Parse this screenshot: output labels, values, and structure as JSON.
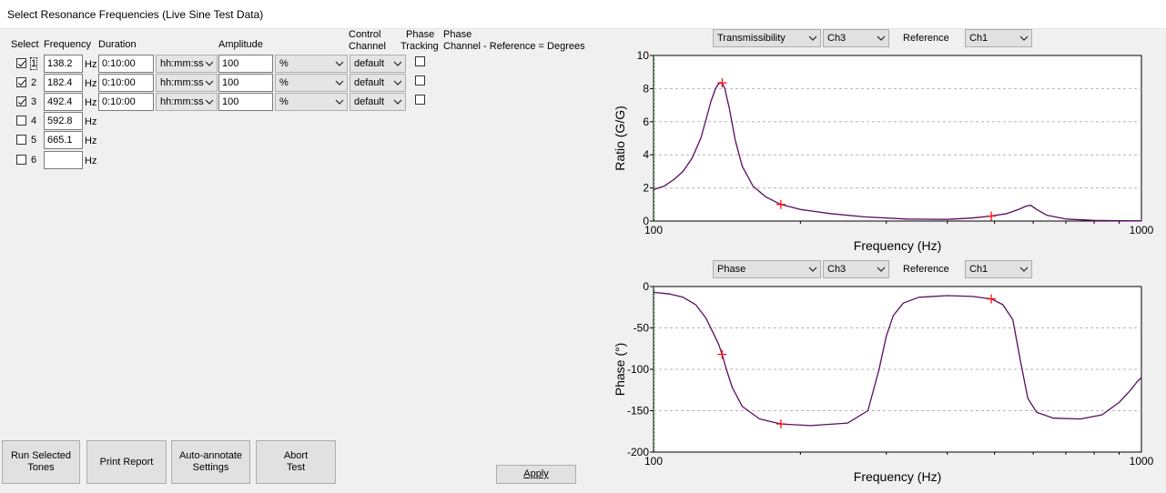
{
  "window": {
    "title": "Select Resonance Frequencies (Live Sine Test Data)"
  },
  "table": {
    "headers": {
      "select": "Select",
      "frequency": "Frequency",
      "duration": "Duration",
      "amplitude": "Amplitude",
      "control_channel_1": "Control",
      "control_channel_2": "Channel",
      "phase_tracking_1": "Phase",
      "phase_tracking_2": "Tracking",
      "phase_1": "Phase",
      "phase_2": "Channel - Reference = Degrees"
    },
    "unit": "Hz",
    "rows": [
      {
        "index": "1",
        "checked": true,
        "frequency": "138.2",
        "duration": "0:10:00",
        "duration_format": "hh:mm:ss",
        "amplitude": "100",
        "amplitude_unit": "%",
        "control_channel": "default",
        "phase_tracking": false
      },
      {
        "index": "2",
        "checked": true,
        "frequency": "182.4",
        "duration": "0:10:00",
        "duration_format": "hh:mm:ss",
        "amplitude": "100",
        "amplitude_unit": "%",
        "control_channel": "default",
        "phase_tracking": false
      },
      {
        "index": "3",
        "checked": true,
        "frequency": "492.4",
        "duration": "0:10:00",
        "duration_format": "hh:mm:ss",
        "amplitude": "100",
        "amplitude_unit": "%",
        "control_channel": "default",
        "phase_tracking": false
      },
      {
        "index": "4",
        "checked": false,
        "frequency": "592.8"
      },
      {
        "index": "5",
        "checked": false,
        "frequency": "665.1"
      },
      {
        "index": "6",
        "checked": false,
        "frequency": ""
      }
    ]
  },
  "buttons": {
    "run_selected_1": "Run Selected",
    "run_selected_2": "Tones",
    "print_report": "Print Report",
    "auto_annotate_1": "Auto-annotate",
    "auto_annotate_2": "Settings",
    "abort_1": "Abort",
    "abort_2": "Test",
    "apply": "Apply"
  },
  "graph_top": {
    "measurement": "Transmissibility",
    "channel": "Ch3",
    "reference_label": "Reference",
    "reference": "Ch1"
  },
  "graph_bottom": {
    "measurement": "Phase",
    "channel": "Ch3",
    "reference_label": "Reference",
    "reference": "Ch1"
  },
  "chart_data": [
    {
      "type": "line",
      "xlabel": "Frequency (Hz)",
      "ylabel": "Ratio (G/G)",
      "x_scale": "log",
      "xlim": [
        100,
        1000
      ],
      "ylim": [
        0,
        10
      ],
      "x_tick_labels": [
        "100",
        "1000"
      ],
      "y_ticks": [
        0,
        2,
        4,
        6,
        8,
        10
      ],
      "grid": "horizontal dashed",
      "line_color": "#5a0b63",
      "marker_color": "#ff0000",
      "x": [
        100,
        105,
        110,
        115,
        120,
        125,
        128,
        131,
        134,
        136,
        138.2,
        140,
        143,
        147,
        152,
        160,
        170,
        182.4,
        200,
        230,
        270,
        330,
        400,
        450,
        492.4,
        530,
        560,
        580,
        592.8,
        610,
        640,
        700,
        800,
        900,
        1000
      ],
      "values": [
        1.9,
        2.1,
        2.5,
        3.0,
        3.8,
        5.0,
        6.1,
        7.2,
        8.0,
        8.3,
        8.35,
        8.0,
        6.8,
        4.9,
        3.3,
        2.1,
        1.45,
        1.0,
        0.7,
        0.45,
        0.25,
        0.12,
        0.1,
        0.18,
        0.3,
        0.45,
        0.7,
        0.9,
        0.95,
        0.7,
        0.35,
        0.12,
        0.04,
        0.02,
        0.01
      ],
      "markers": [
        {
          "x": 138.2,
          "y": 8.35
        },
        {
          "x": 182.4,
          "y": 1.0
        },
        {
          "x": 492.4,
          "y": 0.3
        }
      ]
    },
    {
      "type": "line",
      "xlabel": "Frequency (Hz)",
      "ylabel": "Phase (°)",
      "x_scale": "log",
      "xlim": [
        100,
        1000
      ],
      "ylim": [
        -200,
        0
      ],
      "x_tick_labels": [
        "100",
        "1000"
      ],
      "y_ticks": [
        0,
        -50,
        -100,
        -150,
        -200
      ],
      "grid": "horizontal dashed",
      "line_color": "#5a0b63",
      "marker_color": "#ff0000",
      "x": [
        100,
        108,
        115,
        122,
        128,
        133,
        136,
        138.2,
        141,
        145,
        152,
        165,
        182.4,
        210,
        250,
        275,
        290,
        300,
        310,
        325,
        350,
        400,
        450,
        492.4,
        520,
        545,
        565,
        585,
        610,
        660,
        750,
        830,
        900,
        950,
        980,
        1000
      ],
      "values": [
        -7,
        -9,
        -13,
        -22,
        -38,
        -58,
        -70,
        -82,
        -100,
        -122,
        -145,
        -160,
        -166,
        -168,
        -165,
        -150,
        -100,
        -60,
        -35,
        -20,
        -13,
        -11,
        -12,
        -15,
        -22,
        -40,
        -90,
        -135,
        -152,
        -159,
        -160,
        -155,
        -140,
        -125,
        -115,
        -110
      ],
      "markers": [
        {
          "x": 138.2,
          "y": -82
        },
        {
          "x": 182.4,
          "y": -166
        },
        {
          "x": 492.4,
          "y": -15
        }
      ]
    }
  ]
}
